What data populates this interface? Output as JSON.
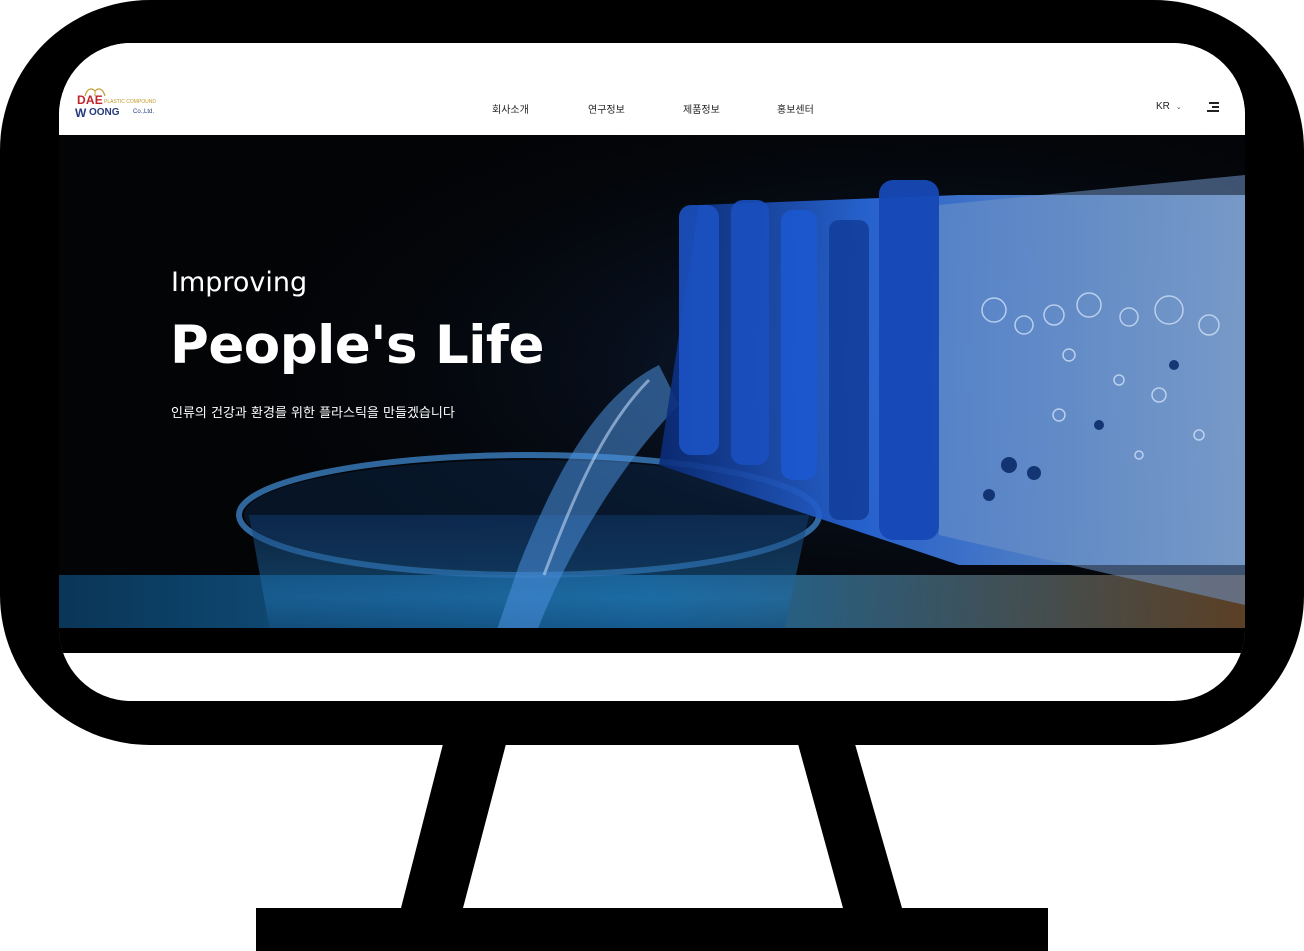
{
  "logo": {
    "line1": "DAE",
    "line2": "OONG",
    "w_glyph": "W",
    "company_suffix": "Co.,Ltd.",
    "tagline": "PLASTIC COMPOUND"
  },
  "nav": {
    "items": [
      {
        "label": "회사소개"
      },
      {
        "label": "연구정보"
      },
      {
        "label": "제품정보"
      },
      {
        "label": "홍보센터"
      }
    ]
  },
  "header": {
    "language": "KR",
    "language_icon": "chevron-down-icon",
    "menu_icon": "hamburger-menu-icon"
  },
  "hero": {
    "kicker": "Improving",
    "title": "People's Life",
    "subtitle": "인류의 건강과 환경를 위한 플라스틱을 만들겠습니다"
  },
  "colors": {
    "logo_red": "#c0242b",
    "logo_navy": "#243a7a",
    "logo_gold": "#c09a2a",
    "hero_background": "#030406",
    "hero_accent_blue": "#1e5fd6"
  }
}
